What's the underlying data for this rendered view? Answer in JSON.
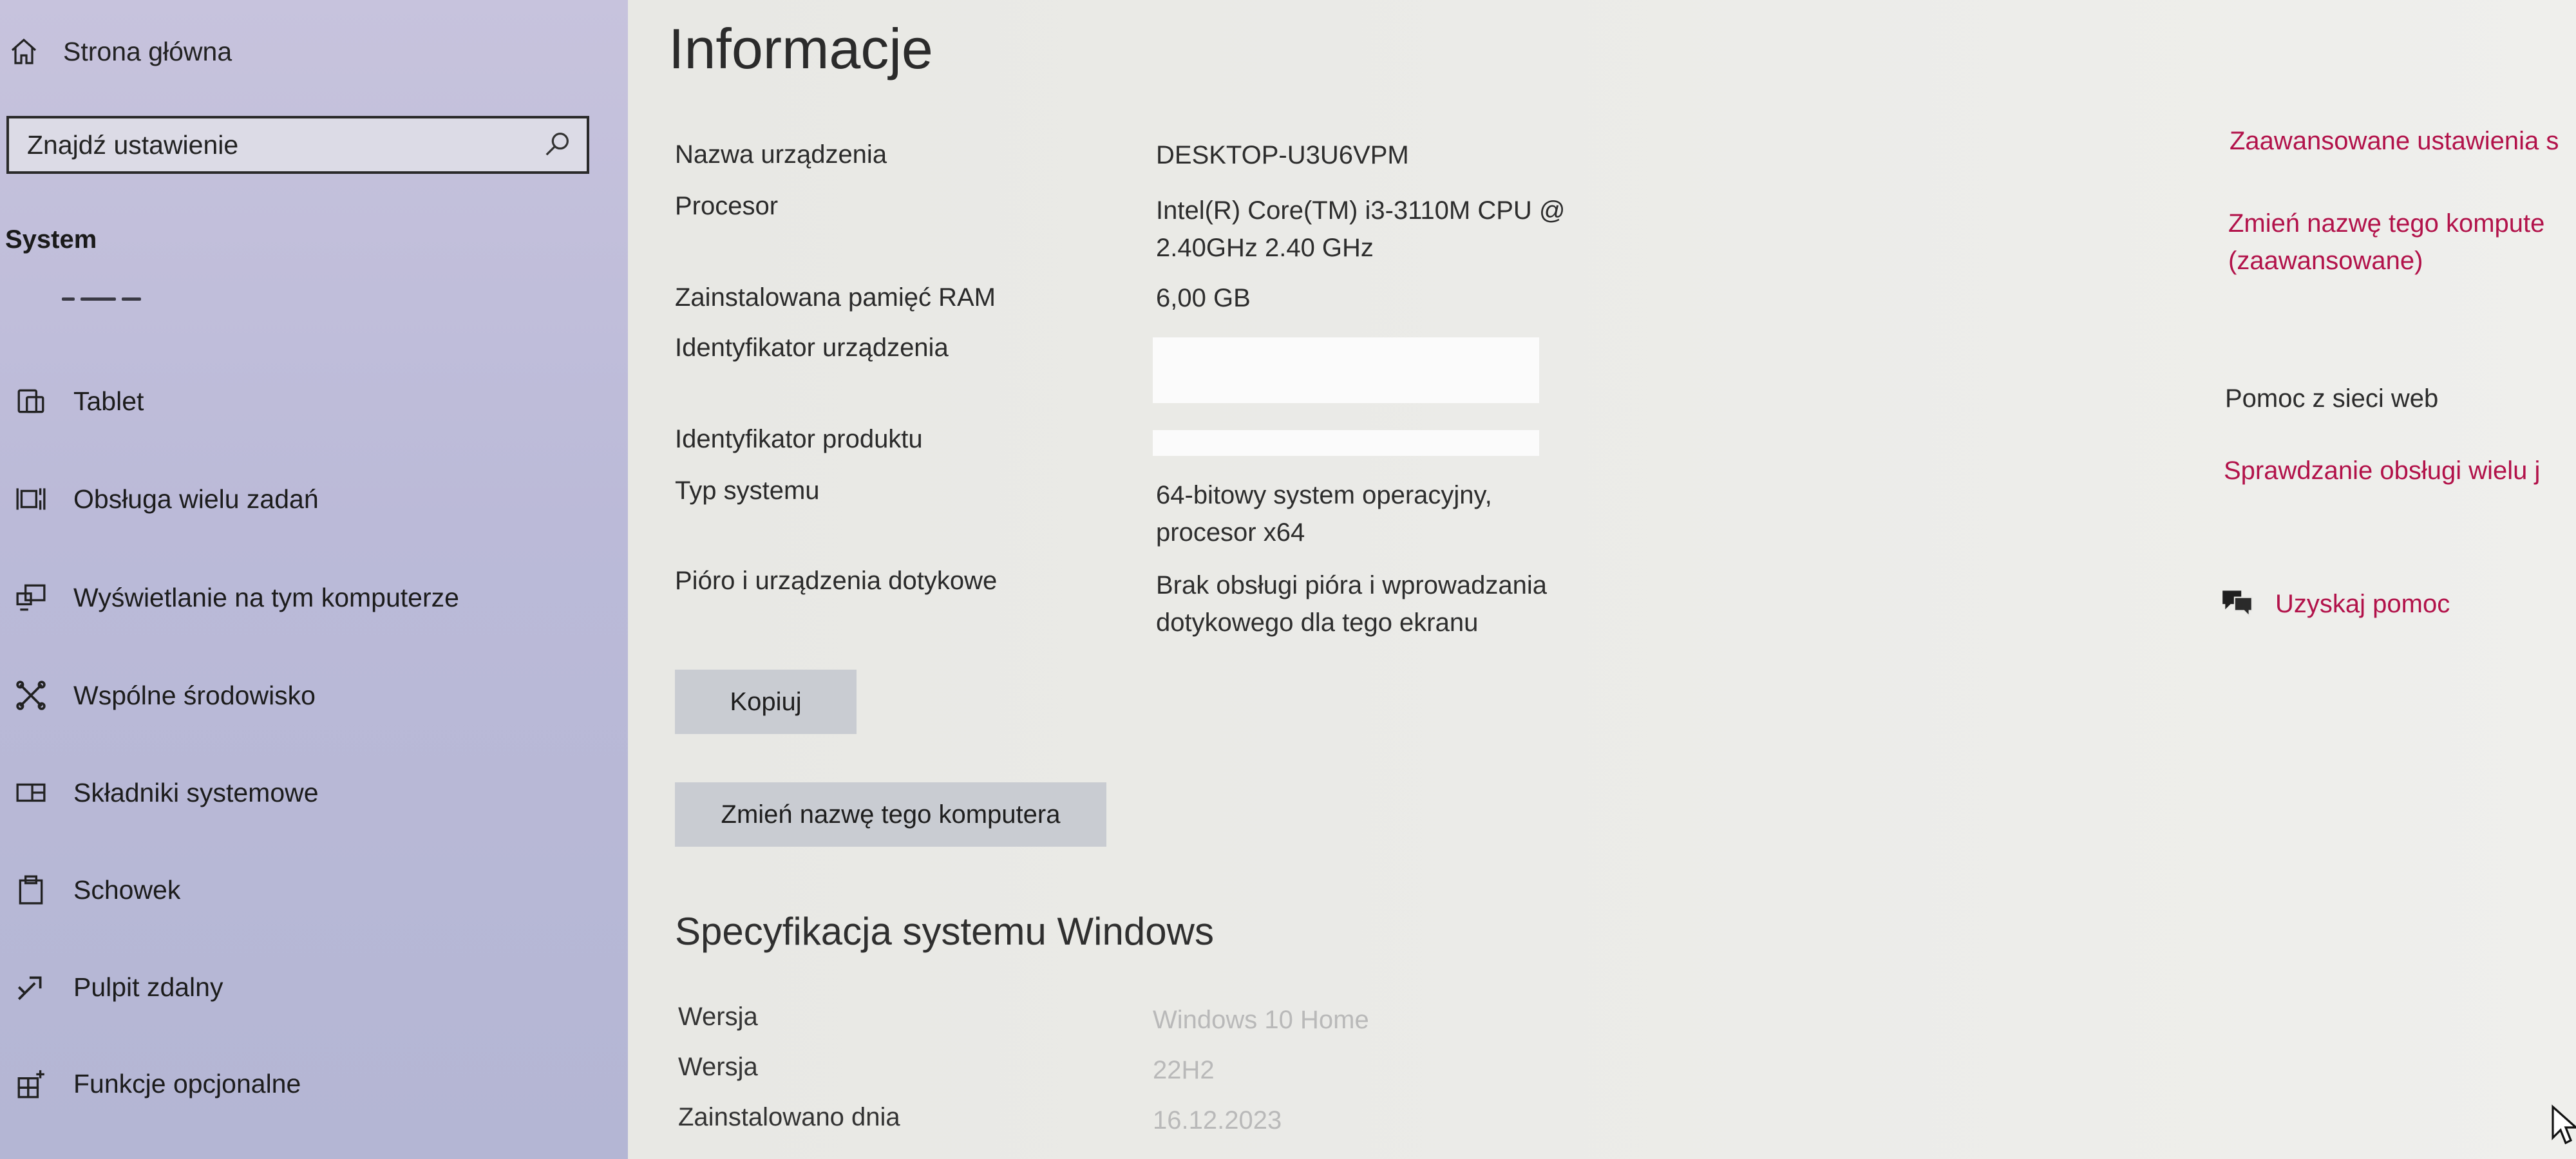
{
  "sidebar": {
    "home_label": "Strona główna",
    "search_placeholder": "Znajdź ustawienie",
    "section_title": "System",
    "items": [
      {
        "label": "Tablet",
        "icon": "tablet-icon"
      },
      {
        "label": "Obsługa wielu zadań",
        "icon": "multitasking-icon"
      },
      {
        "label": "Wyświetlanie na tym komputerze",
        "icon": "projecting-icon"
      },
      {
        "label": "Wspólne środowisko",
        "icon": "shared-experiences-icon"
      },
      {
        "label": "Składniki systemowe",
        "icon": "system-components-icon"
      },
      {
        "label": "Schowek",
        "icon": "clipboard-icon"
      },
      {
        "label": "Pulpit zdalny",
        "icon": "remote-desktop-icon"
      },
      {
        "label": "Funkcje opcjonalne",
        "icon": "optional-features-icon"
      }
    ]
  },
  "main": {
    "title": "Informacje",
    "device": {
      "name_label": "Nazwa urządzenia",
      "name_value": "DESKTOP-U3U6VPM",
      "processor_label": "Procesor",
      "processor_value_line1": "Intel(R) Core(TM) i3-3110M CPU @",
      "processor_value_line2": "2.40GHz   2.40 GHz",
      "ram_label": "Zainstalowana pamięć RAM",
      "ram_value": "6,00 GB",
      "device_id_label": "Identyfikator urządzenia",
      "product_id_label": "Identyfikator produktu",
      "system_type_label": "Typ systemu",
      "system_type_line1": "64-bitowy system operacyjny,",
      "system_type_line2": "procesor x64",
      "pen_label": "Pióro i urządzenia dotykowe",
      "pen_line1": "Brak obsługi pióra i wprowadzania",
      "pen_line2": "dotykowego dla tego ekranu"
    },
    "copy_button": "Kopiuj",
    "rename_button": "Zmień nazwę tego komputera",
    "spec": {
      "title": "Specyfikacja systemu Windows",
      "edition_label": "Wersja",
      "edition_value": "Windows 10 Home",
      "version_label": "Wersja",
      "version_value": "22H2",
      "installed_label": "Zainstalowano dnia",
      "installed_value": "16.12.2023"
    }
  },
  "related": {
    "advanced_settings": "Zaawansowane ustawienia s",
    "rename_advanced_line1": "Zmień nazwę tego kompute",
    "rename_advanced_line2": "(zaawansowane)",
    "web_help_title": "Pomoc z sieci web",
    "multi_check": "Sprawdzanie obsługi wielu j",
    "get_help": "Uzyskaj pomoc"
  },
  "colors": {
    "link": "#b2124a",
    "sidebar_bg": "#bbbad8",
    "main_bg": "#ecece9",
    "button_bg": "#c9ccd2"
  }
}
